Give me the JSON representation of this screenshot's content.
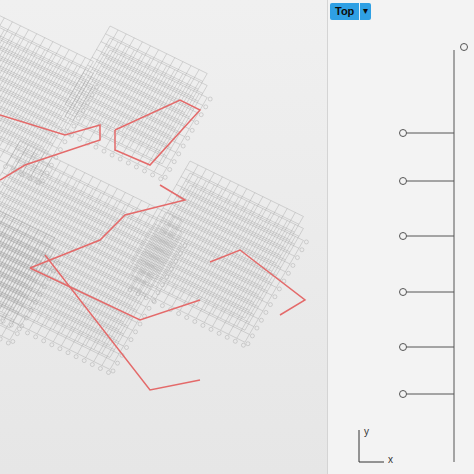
{
  "viewport": {
    "label": "Top",
    "menu": "▾"
  },
  "axes": {
    "y": "y",
    "x": "x"
  }
}
